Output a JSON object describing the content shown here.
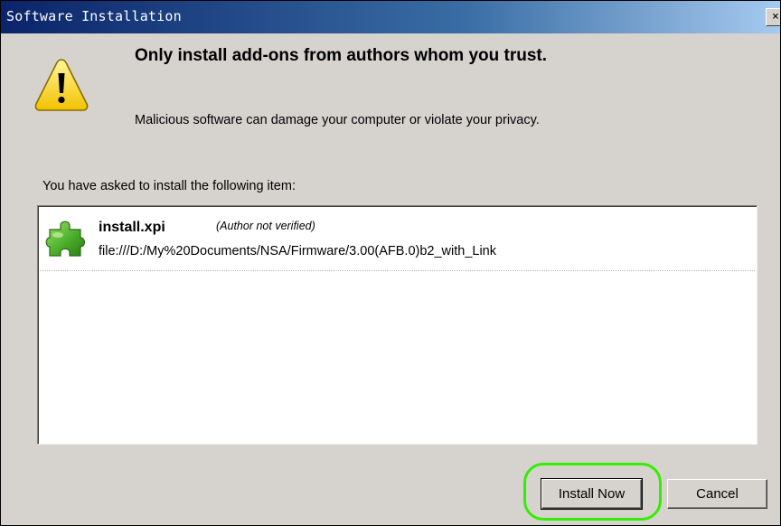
{
  "window": {
    "title": "Software Installation",
    "close_glyph": "×"
  },
  "warning": {
    "icon": "warning-icon",
    "headline": "Only install add-ons from authors whom you trust.",
    "subtext": "Malicious software can damage your computer or violate your privacy."
  },
  "install_list": {
    "label": "You have asked to install the following item:",
    "items": [
      {
        "icon": "puzzle-piece-icon",
        "name": "install.xpi",
        "author_note": "(Author not verified)",
        "url": "file:///D:/My%20Documents/NSA/Firmware/3.00(AFB.0)b2_with_Link"
      }
    ]
  },
  "buttons": {
    "install": "Install Now",
    "cancel": "Cancel"
  },
  "colors": {
    "dialog_bg": "#d6d3ce",
    "titlebar_start": "#0a246a",
    "titlebar_end": "#a6caf0",
    "highlight": "#33ee00"
  }
}
